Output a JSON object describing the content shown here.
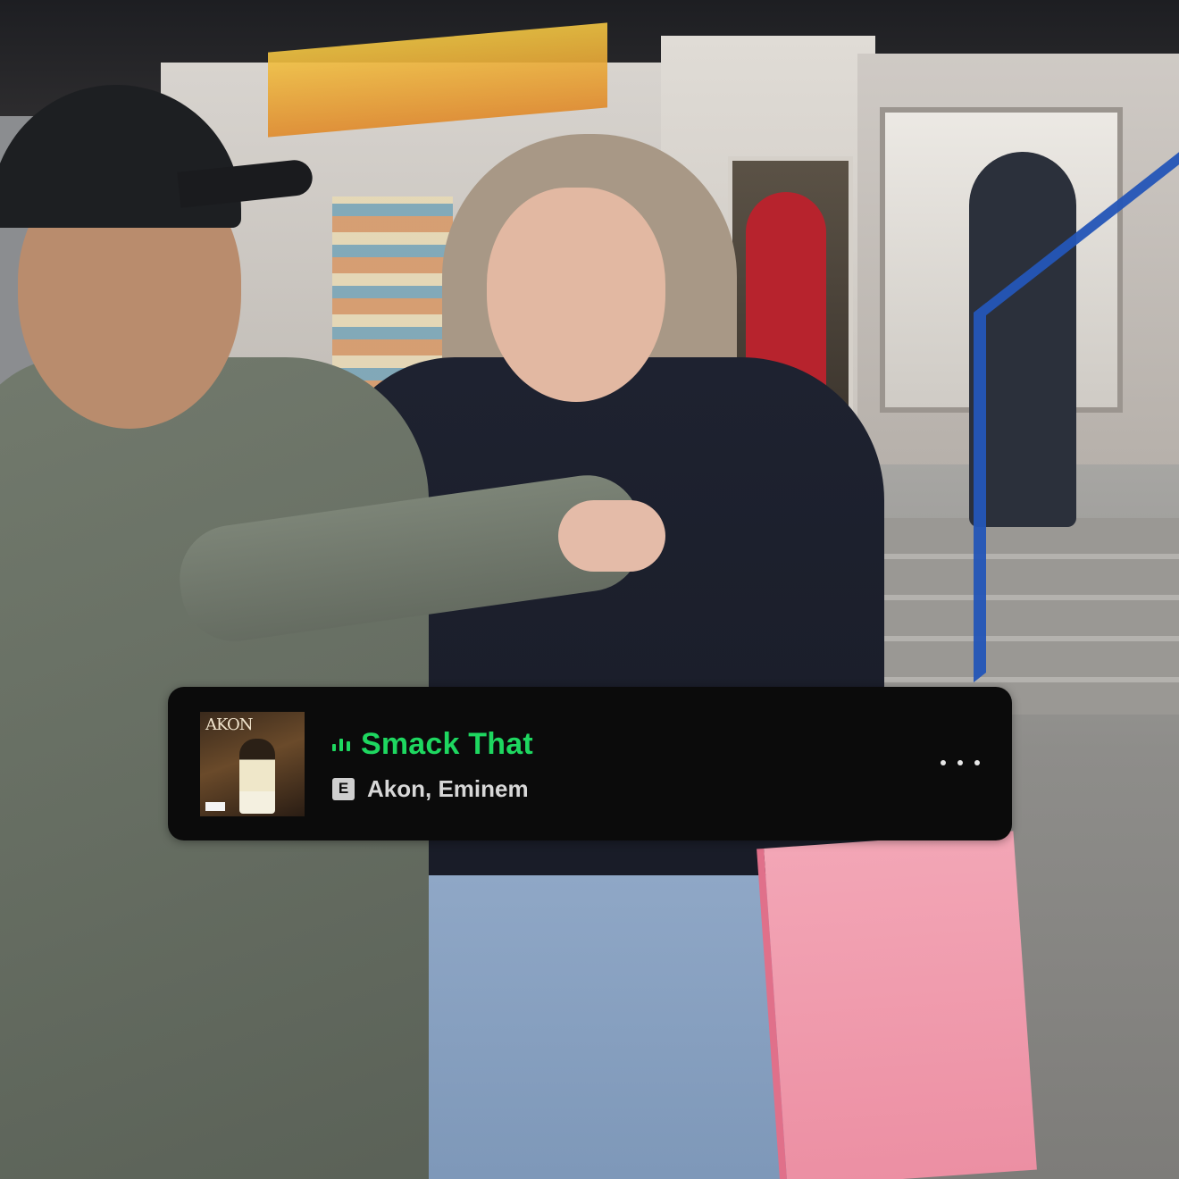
{
  "now_playing": {
    "title": "Smack That",
    "artists": "Akon, Eminem",
    "explicit_badge": "E",
    "album_art_text": "AKON",
    "accent_color": "#1ed760",
    "icons": {
      "playing": "now-playing-bars-icon",
      "more": "more-horizontal-icon",
      "explicit": "explicit-icon"
    }
  }
}
